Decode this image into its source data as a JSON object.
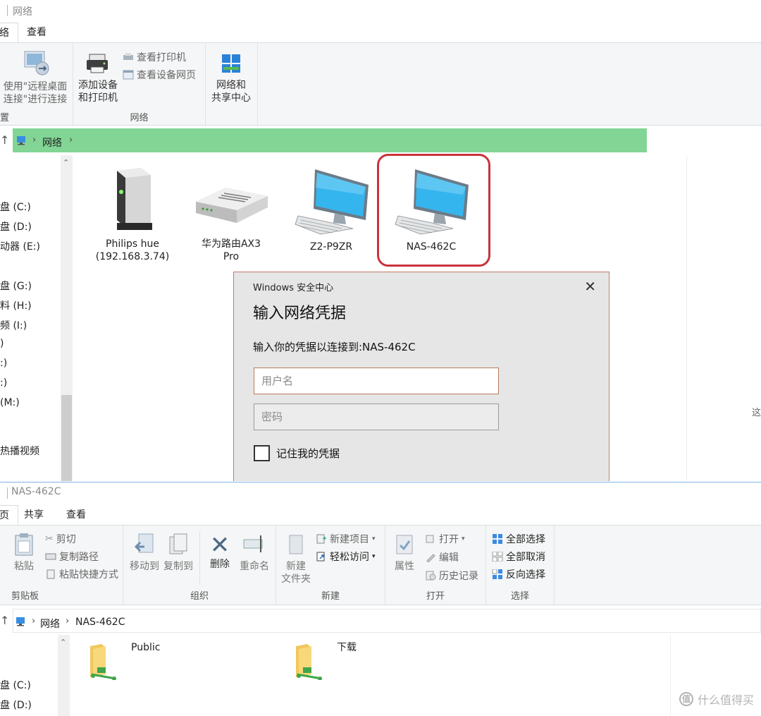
{
  "window_top": {
    "title": "网络",
    "tabs": [
      "络",
      "查看"
    ],
    "ribbon": {
      "remote_desktop": "使用\"远程桌面\n连接\"进行连接",
      "group1_label": "置",
      "add_device": "添加设备\n和打印机",
      "view_printers": "查看打印机",
      "view_device_web": "查看设备网页",
      "group2_label": "网络",
      "network_center": "网络和\n共享中心"
    },
    "address": {
      "crumb": "网络"
    },
    "nav": [
      "盘 (C:)",
      "盘 (D:)",
      "动器 (E:)",
      "盘 (G:)",
      "料 (H:)",
      "频 (I:)",
      ")",
      ":)",
      ":)",
      "(M:)",
      "热播视频"
    ],
    "items": [
      {
        "label": "Philips hue\n(192.168.3.74)"
      },
      {
        "label": "华为路由AX3\nPro"
      },
      {
        "label": "Z2-P9ZR"
      },
      {
        "label": "NAS-462C"
      }
    ],
    "right_edge_char": "这"
  },
  "dialog": {
    "caption": "Windows 安全中心",
    "title": "输入网络凭据",
    "message": "输入你的凭据以连接到:NAS-462C",
    "username_placeholder": "用户名",
    "password_placeholder": "密码",
    "remember": "记住我的凭据"
  },
  "window_bottom": {
    "title": "NAS-462C",
    "tabs": [
      "页",
      "共享",
      "查看"
    ],
    "ribbon": {
      "paste": "粘贴",
      "cut": "剪切",
      "copy_path": "复制路径",
      "paste_shortcut": "粘贴快捷方式",
      "clipboard_label": "剪贴板",
      "move_to": "移动到",
      "copy_to": "复制到",
      "delete": "删除",
      "rename": "重命名",
      "organize_label": "组织",
      "new_folder": "新建\n文件夹",
      "new_item": "新建项目",
      "easy_access": "轻松访问",
      "new_label": "新建",
      "properties": "属性",
      "open": "打开",
      "edit": "编辑",
      "history": "历史记录",
      "open_label": "打开",
      "select_all": "全部选择",
      "select_none": "全部取消",
      "invert_select": "反向选择",
      "select_label": "选择"
    },
    "address": {
      "crumb1": "网络",
      "crumb2": "NAS-462C"
    },
    "nav": [
      "盘 (C:)",
      "盘 (D:)"
    ],
    "folders": [
      {
        "label": "Public"
      },
      {
        "label": "下载"
      }
    ]
  },
  "watermark": {
    "text": "什么值得买",
    "logo": "值"
  },
  "colors": {
    "address_highlight": "#82d595",
    "highlight_ring": "#c9333b",
    "dialog_bg": "#e6e6e6"
  }
}
